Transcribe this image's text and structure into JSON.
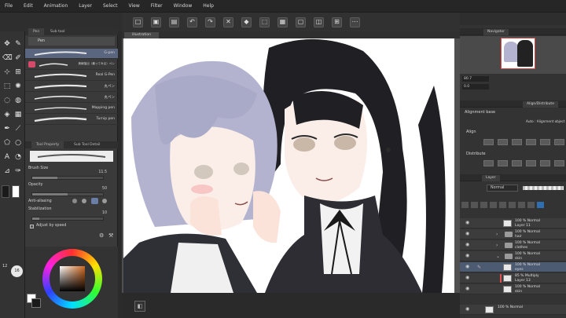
{
  "menu": [
    "File",
    "Edit",
    "Animation",
    "Layer",
    "Select",
    "View",
    "Filter",
    "Window",
    "Help"
  ],
  "canvas_tab": "illustration",
  "brush_panel": {
    "tab_labels": [
      "Pen",
      "Sub tool"
    ],
    "header": "Pen",
    "brushes": [
      {
        "label": "G-pen"
      },
      {
        "label": "美線抽出（最ってみる）ペン"
      },
      {
        "label": "Real G-Pen"
      },
      {
        "label": "丸ペン"
      },
      {
        "label": "丸ペン"
      },
      {
        "label": "Mapping pen"
      },
      {
        "label": "Turnip pen"
      }
    ],
    "detail_tabs": [
      "Tool Property",
      "Sub Tool Detail"
    ],
    "properties": {
      "brush_size_label": "Brush Size",
      "brush_size_value": "11.5",
      "opacity_label": "Opacity",
      "opacity_value": "50",
      "anti_aliasing_label": "Anti-aliasing",
      "stabilization_label": "Stabilization",
      "stabilization_value": "10",
      "adjust_label": "Adjust by speed"
    }
  },
  "tool_strip": {
    "size_values": [
      "12",
      "16"
    ]
  },
  "right_panel": {
    "navigator_tab": "Navigator",
    "zoom_value": "80.7",
    "angle_value": "0.0",
    "align_tab": "Align/Distribute",
    "alignment_base_label": "Alignment base",
    "alignment_base_value": "Auto : Alignment object",
    "align_label": "Align",
    "distribute_label": "Distribute",
    "layer_tab": "Layer",
    "blend_mode": "Normal",
    "opacity_value": "100",
    "layers": [
      {
        "line1": "100 % Normal",
        "line2": "Layer 11",
        "type": "layer",
        "selected": false
      },
      {
        "line1": "100 % Normal",
        "line2": "hair",
        "type": "folder",
        "selected": false
      },
      {
        "line1": "100 % Normal",
        "line2": "clothes",
        "type": "folder",
        "selected": false
      },
      {
        "line1": "100 % Normal",
        "line2": "skin",
        "type": "folder",
        "selected": false
      },
      {
        "line1": "100 % Normal",
        "line2": "eyes",
        "type": "layer",
        "selected": true
      },
      {
        "line1": "85 % Multiply",
        "line2": "Layer 13",
        "type": "layer",
        "selected": false
      },
      {
        "line1": "100 % Normal",
        "line2": "skin",
        "type": "layer",
        "selected": false
      },
      {
        "line1": "100 % Normal",
        "line2": "",
        "type": "layer",
        "selected": false
      }
    ]
  },
  "colors": {
    "accent": "#4c5a72",
    "main_color": "#ffffff",
    "sub_color": "#1a1a1a"
  }
}
